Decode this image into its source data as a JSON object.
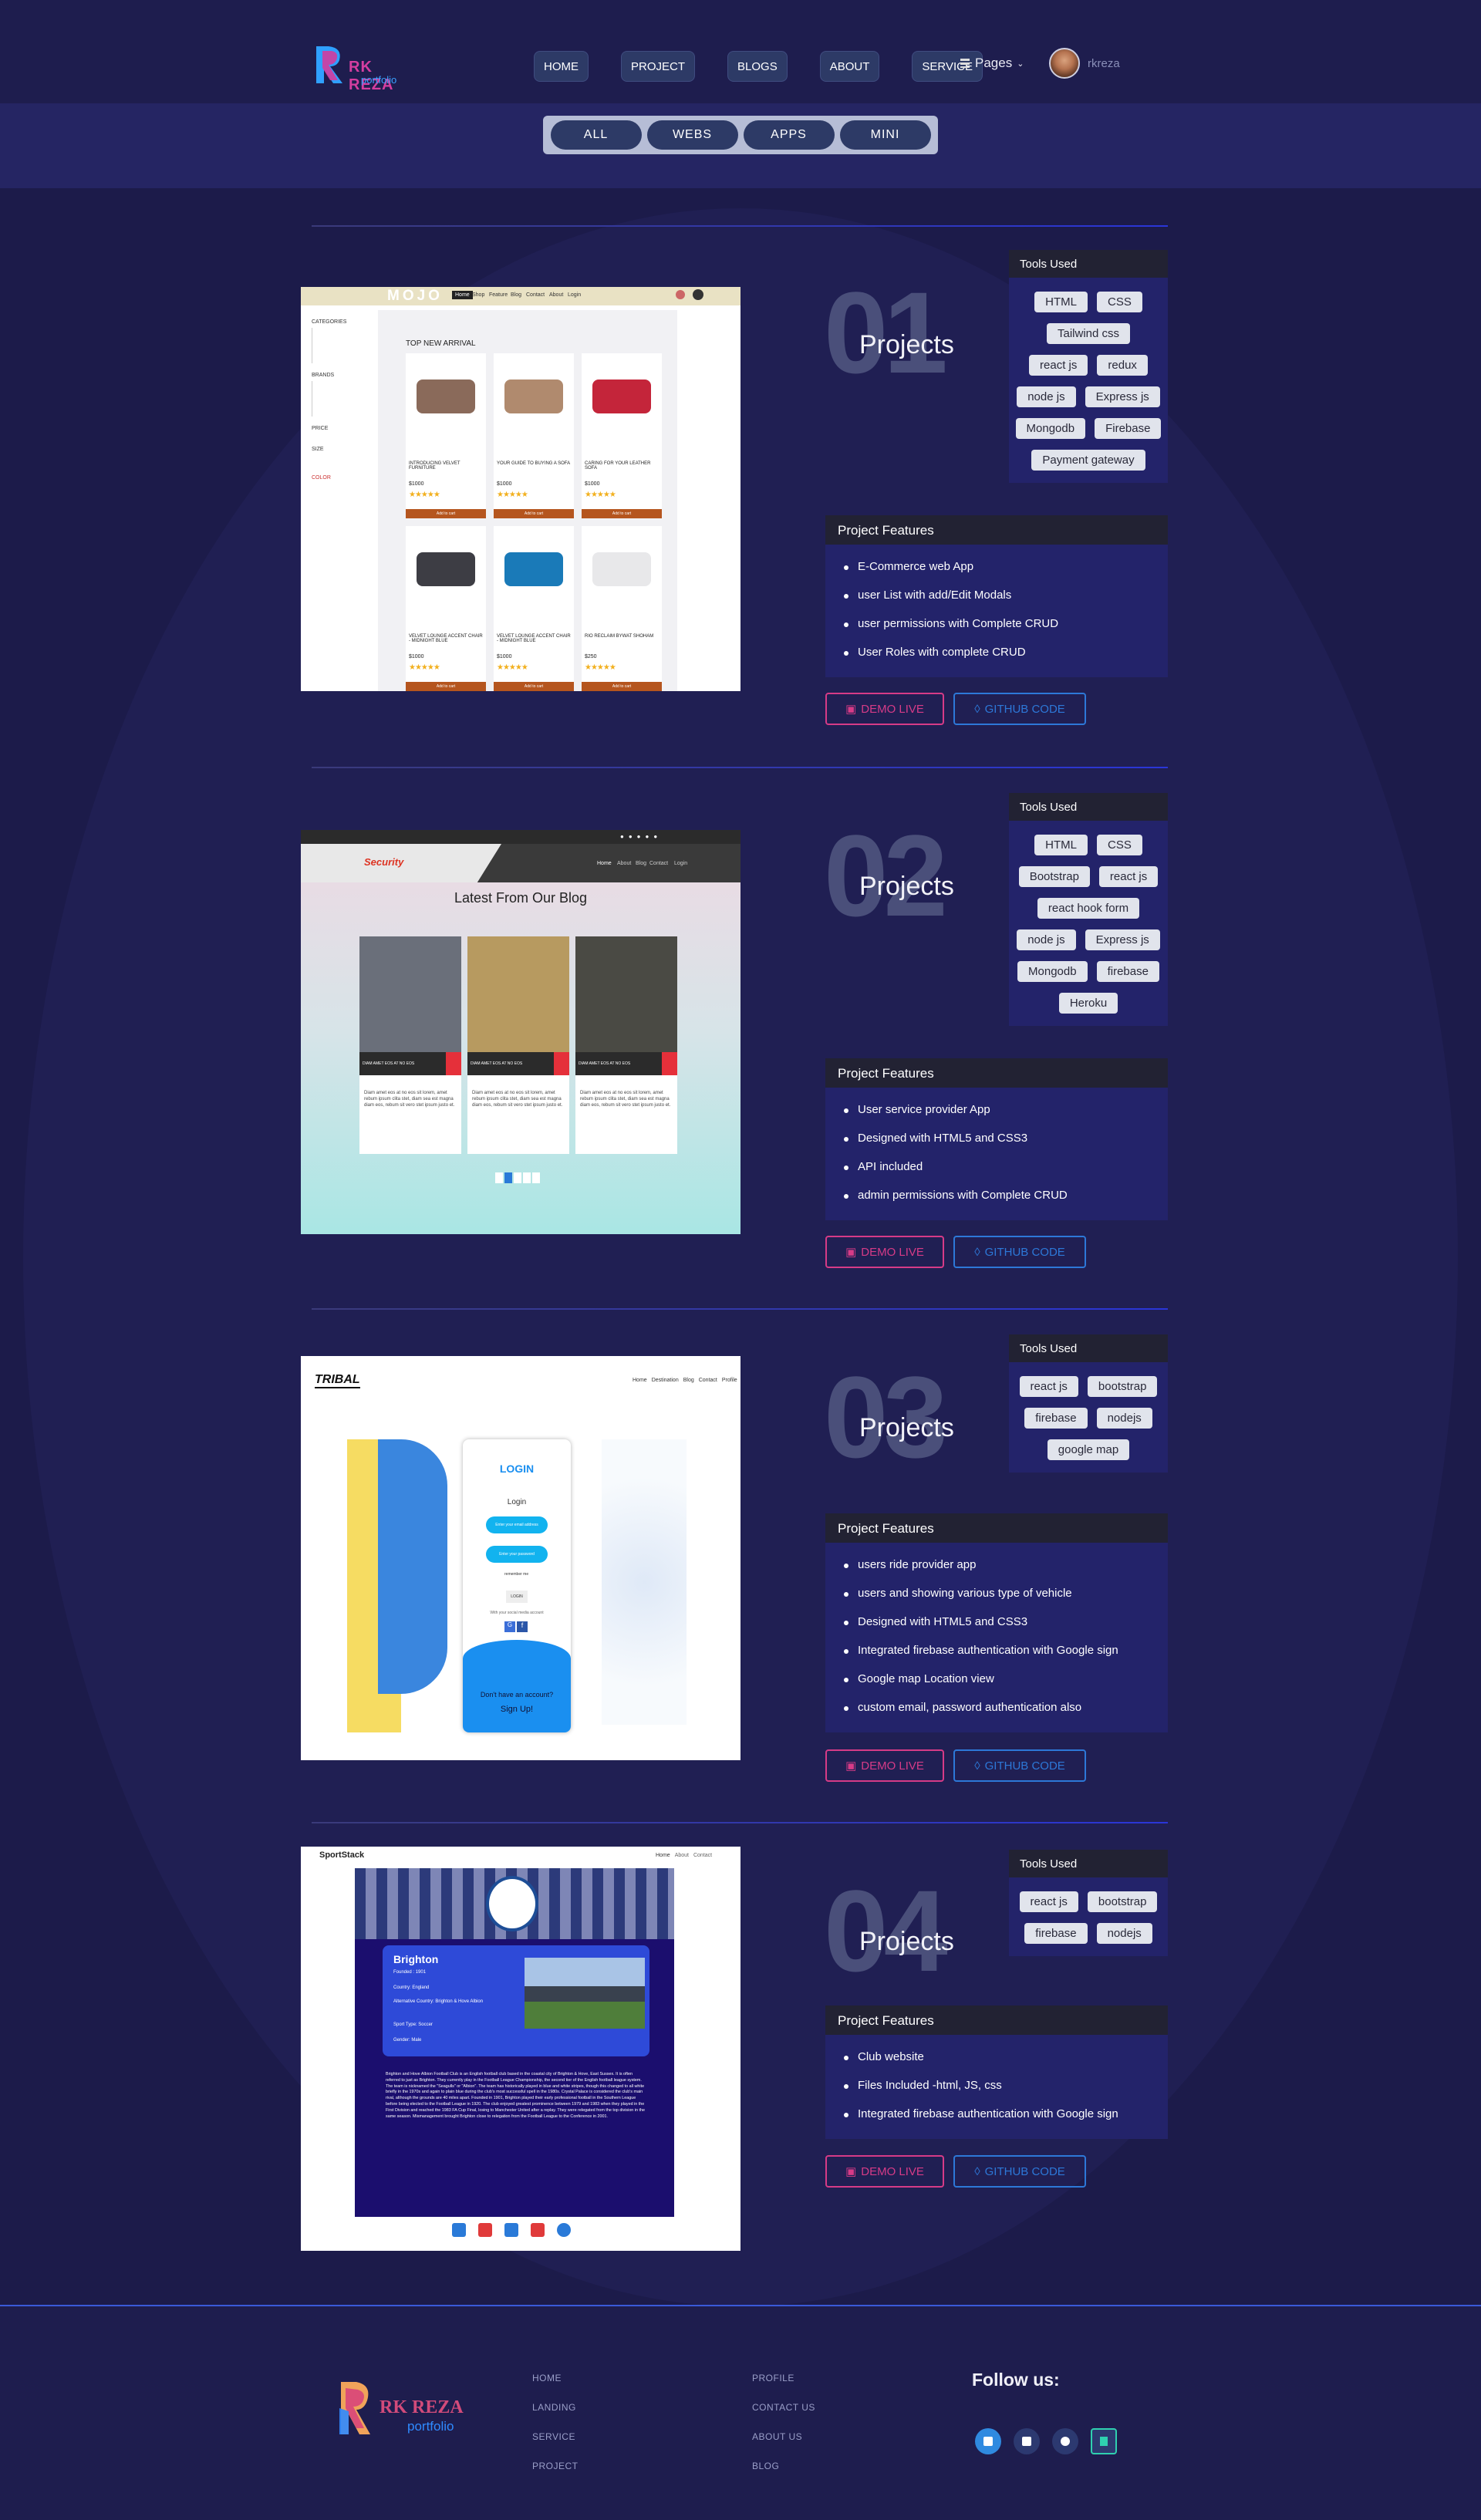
{
  "header": {
    "logo_text": "RK REZA",
    "logo_sub": "portfolio",
    "nav": [
      "HOME",
      "PROJECT",
      "BLOGS",
      "ABOUT",
      "SERVICE"
    ],
    "pages_label": "Pages",
    "username": "rkreza"
  },
  "filters": [
    "ALL",
    "WEBS",
    "APPS",
    "MINI"
  ],
  "tools_title": "Tools Used",
  "features_title": "Project Features",
  "projects_label": "Projects",
  "demo_label": "DEMO LIVE",
  "github_label": "GITHUB CODE",
  "projects": [
    {
      "number": "01",
      "tools": [
        "HTML",
        "CSS",
        "Tailwind css",
        "react js",
        "redux",
        "node js",
        "Express js",
        "Mongodb",
        "Firebase",
        "Payment gateway"
      ],
      "features": [
        "E-Commerce web App",
        "user List with add/Edit Modals",
        "user permissions with Complete CRUD",
        "User Roles with complete CRUD"
      ],
      "shot": {
        "brand": "MOJO",
        "nav": [
          "Home",
          "Shop",
          "Feature",
          "Blog",
          "Contact",
          "About",
          "Login"
        ],
        "heading": "TOP NEW ARRIVAL",
        "sidebar": [
          "CATEGORIES",
          "BRANDS",
          "PRICE",
          "SIZE",
          "COLOR"
        ],
        "products": [
          {
            "name": "INTRODUCING VELVET FURNITURE",
            "price": "$1000",
            "color": "#8a6a5a"
          },
          {
            "name": "YOUR GUIDE TO BUYING A SOFA",
            "price": "$1000",
            "color": "#b08a6e"
          },
          {
            "name": "CARING FOR YOUR LEATHER SOFA",
            "price": "$1000",
            "color": "#c4253a"
          },
          {
            "name": "VELVET LOUNGE ACCENT CHAIR - MIDNIGHT BLUE",
            "price": "$1000",
            "color": "#3d3d44"
          },
          {
            "name": "VELVET LOUNGE ACCENT CHAIR - MIDNIGHT BLUE",
            "price": "$1000",
            "color": "#1a7ab8"
          },
          {
            "name": "RIO RECLAIM BYWAT SHOHAM",
            "price": "$250",
            "color": "#e8e8ea"
          }
        ],
        "cta": "Add to cart"
      }
    },
    {
      "number": "02",
      "tools": [
        "HTML",
        "CSS",
        "Bootstrap",
        "react js",
        "react hook form",
        "node js",
        "Express js",
        "Mongodb",
        "firebase",
        "Heroku"
      ],
      "features": [
        "User service provider App",
        "Designed with HTML5 and CSS3",
        "API included",
        "admin permissions with Complete CRUD"
      ],
      "shot": {
        "brand": "Security",
        "nav": [
          "Home",
          "About",
          "Blog",
          "Contact",
          "Login"
        ],
        "heading": "Latest From Our Blog",
        "card_title": "DIAM AMET EOS AT NO EOS",
        "card_text": "Diam amet eos at no eos sit lorem, amet rebum ipsum clita stet, diam sea est magna diam eos, rebum sit vero stet ipsum justo et."
      }
    },
    {
      "number": "03",
      "tools": [
        "react js",
        "bootstrap",
        "firebase",
        "nodejs",
        "google map"
      ],
      "features": [
        "users ride provider app",
        "users and showing various type of vehicle",
        "Designed with HTML5 and CSS3",
        "Integrated firebase authentication with Google sign",
        "Google map Location view",
        "custom email, password authentication also"
      ],
      "shot": {
        "brand": "TRIBAL",
        "nav": [
          "Home",
          "Destination",
          "Blog",
          "Contact",
          "Profile"
        ],
        "heading": "LOGIN",
        "sub": "Login",
        "email": "Enter your email address",
        "password": "Enter your password",
        "remember": "remember me",
        "login_btn": "LOGIN",
        "or_text": "With your social media account",
        "no_account": "Don't have an account?",
        "signup": "Sign Up!"
      }
    },
    {
      "number": "04",
      "tools": [
        "react js",
        "bootstrap",
        "firebase",
        "nodejs"
      ],
      "features": [
        "Club website",
        "Files Included -html, JS, css",
        "Integrated firebase authentication with Google sign"
      ],
      "shot": {
        "brand": "SportStack",
        "nav": [
          "Home",
          "About",
          "Contact"
        ],
        "club": "Brighton",
        "founded": "Founded : 1901",
        "info": [
          "Country: England",
          "Alternative Country: Brighton & Hove Albion",
          "Sport Type: Soccer",
          "Gender: Male"
        ],
        "description": "Brighton and Hove Albion Football Club is an English football club based in the coastal city of Brighton & Hove, East Sussex. It is often referred to just as Brighton. They currently play in the Football League Championship, the second tier of the English football league system. The team is nicknamed the \"Seagulls\" or \"Albion\". The team has historically played in blue and white stripes, though this changed to all white briefly in the 1970s and again to plain blue during the club's most successful spell in the 1980s. Crystal Palace is considered the club's main rival, although the grounds are 40 miles apart. Founded in 1901, Brighton played their early professional football in the Southern League before being elected to the Football League in 1920. The club enjoyed greatest prominence between 1979 and 1983 when they played in the First Division and reached the 1983 FA Cup Final, losing to Manchester United after a replay. They were relegated from the top division in the same season. Mismanagement brought Brighton close to relegation from the Football League to the Conference in 2001."
      }
    }
  ],
  "footer": {
    "logo_text": "RK REZA",
    "logo_sub": "portfolio",
    "col1": [
      "HOME",
      "LANDING",
      "SERVICE",
      "PROJECT"
    ],
    "col2": [
      "PROFILE",
      "CONTACT US",
      "ABOUT US",
      "BLOG"
    ],
    "follow": "Follow us:",
    "social": [
      "linkedin-icon",
      "facebook-icon",
      "github-icon",
      "resume-icon"
    ]
  }
}
